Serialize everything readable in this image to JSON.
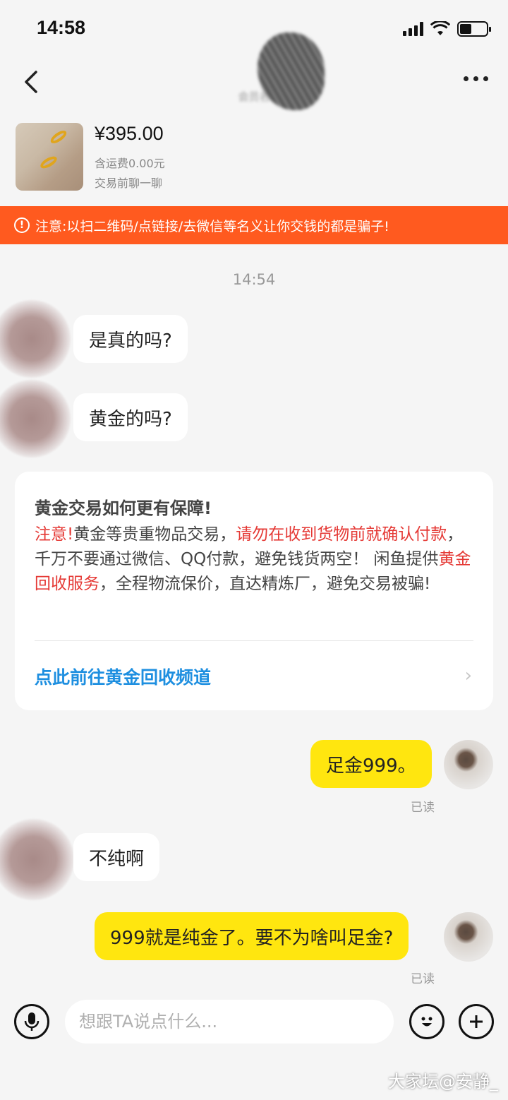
{
  "status_bar": {
    "time": "14:58"
  },
  "header": {
    "contact_name": "",
    "contact_sub": "会员名"
  },
  "product": {
    "price": "¥395.00",
    "shipping": "含运费0.00元",
    "chat_hint": "交易前聊一聊"
  },
  "warning": {
    "icon": "!",
    "text": "注意:以扫二维码/点链接/去微信等名义让你交钱的都是骗子!"
  },
  "chat": {
    "timestamp": "14:54",
    "messages": [
      {
        "side": "left",
        "text": "是真的吗?"
      },
      {
        "side": "left",
        "text": "黄金的吗?"
      },
      {
        "side": "right",
        "text": "足金999。",
        "status": "已读"
      },
      {
        "side": "left",
        "text": "不纯啊"
      },
      {
        "side": "right",
        "text": "999就是纯金了。要不为啥叫足金?",
        "status": "已读"
      }
    ]
  },
  "notice_card": {
    "title": "黄金交易如何更有保障!",
    "body_parts": [
      {
        "text": "注意!",
        "highlight": true
      },
      {
        "text": "黄金等贵重物品交易，",
        "highlight": false
      },
      {
        "text": "请勿在收到货物前就确认付款",
        "highlight": true
      },
      {
        "text": "，千万不要通过微信、QQ付款，避免钱货两空！ 闲鱼提供",
        "highlight": false
      },
      {
        "text": "黄金回收服务",
        "highlight": true
      },
      {
        "text": "，全程物流保价，直达精炼厂，避免交易被骗!",
        "highlight": false
      }
    ],
    "link_text": "点此前往黄金回收频道"
  },
  "input": {
    "placeholder": "想跟TA说点什么..."
  },
  "icons": {
    "back": "chevron-left-icon",
    "more": "more-dots-icon",
    "voice": "microphone-icon",
    "emoji": "emoji-icon",
    "add": "plus-icon",
    "warning": "info-circle-icon"
  },
  "colors": {
    "warning_bg": "#ff5a1f",
    "my_bubble": "#ffe60f",
    "link": "#1e8fe0",
    "highlight_red": "#e53935"
  },
  "watermark": "大家坛@安静_"
}
